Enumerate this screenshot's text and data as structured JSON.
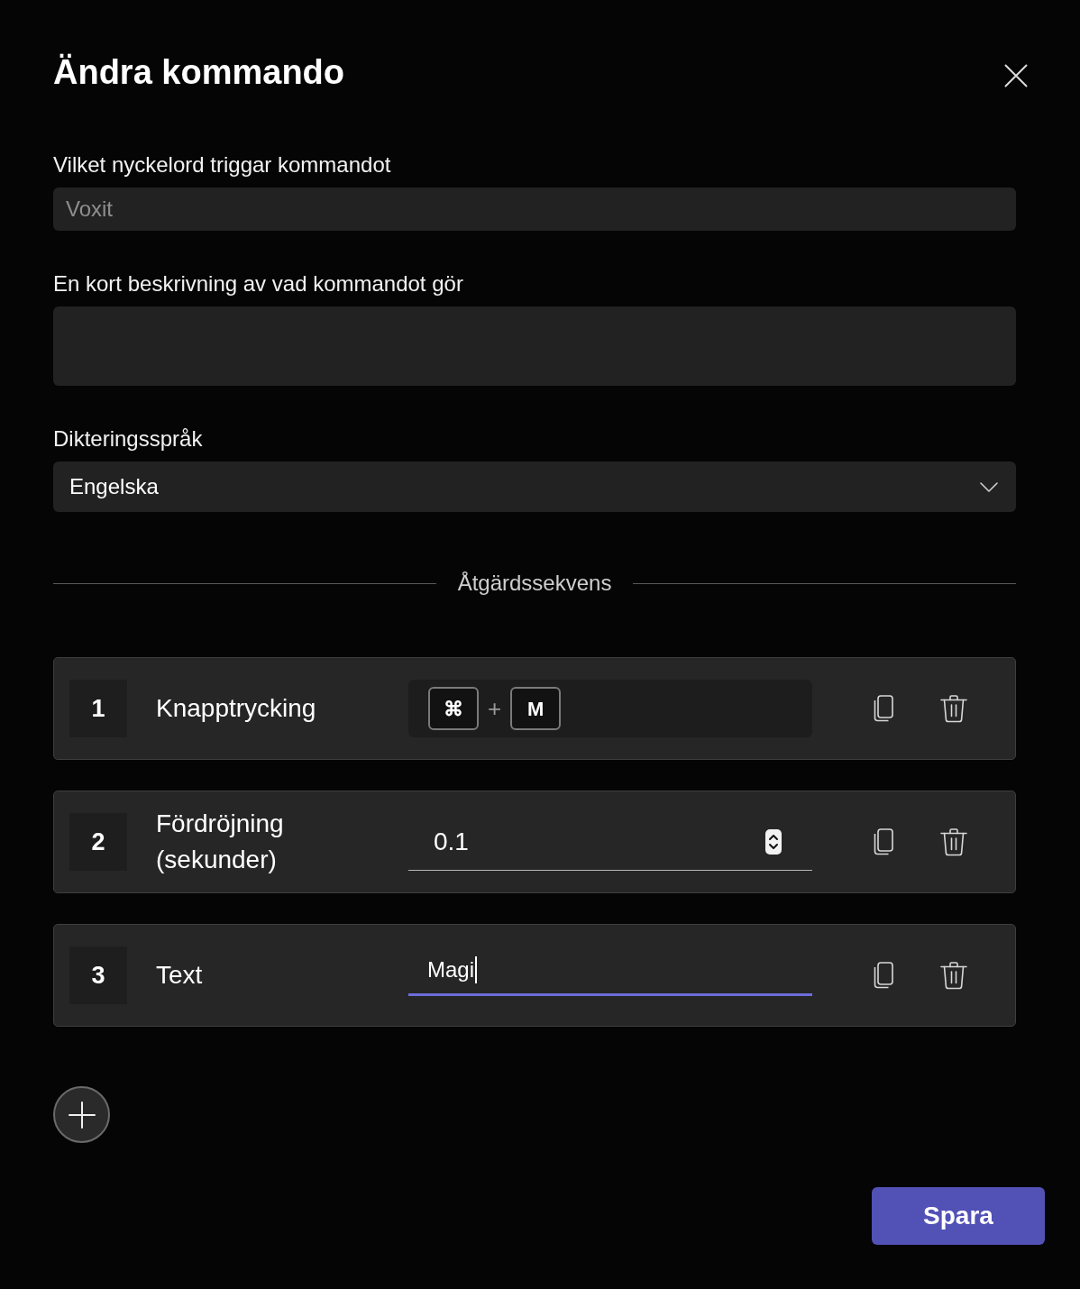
{
  "dialog": {
    "title": "Ändra kommando"
  },
  "fields": [
    {
      "kind": "text",
      "label": "Vilket nyckelord triggar kommandot",
      "placeholder": "Voxit"
    },
    {
      "kind": "textarea",
      "label": "En kort beskrivning av vad kommandot gör"
    },
    {
      "kind": "select",
      "label": "Dikteringsspråk",
      "value": "Engelska"
    }
  ],
  "sequence": {
    "title": "Åtgärdssekvens",
    "actions": [
      {
        "number": "1",
        "kind": "keys",
        "label": "Knapptrycking",
        "keys": [
          "⌘",
          "M"
        ],
        "separator": "+"
      },
      {
        "number": "2",
        "kind": "number",
        "label": "Fördröjning (sekunder)",
        "value": "0.1",
        "focused": false
      },
      {
        "number": "3",
        "kind": "text",
        "label": "Text",
        "value": "Magi",
        "focused": true
      }
    ]
  },
  "save_button": "Spara"
}
